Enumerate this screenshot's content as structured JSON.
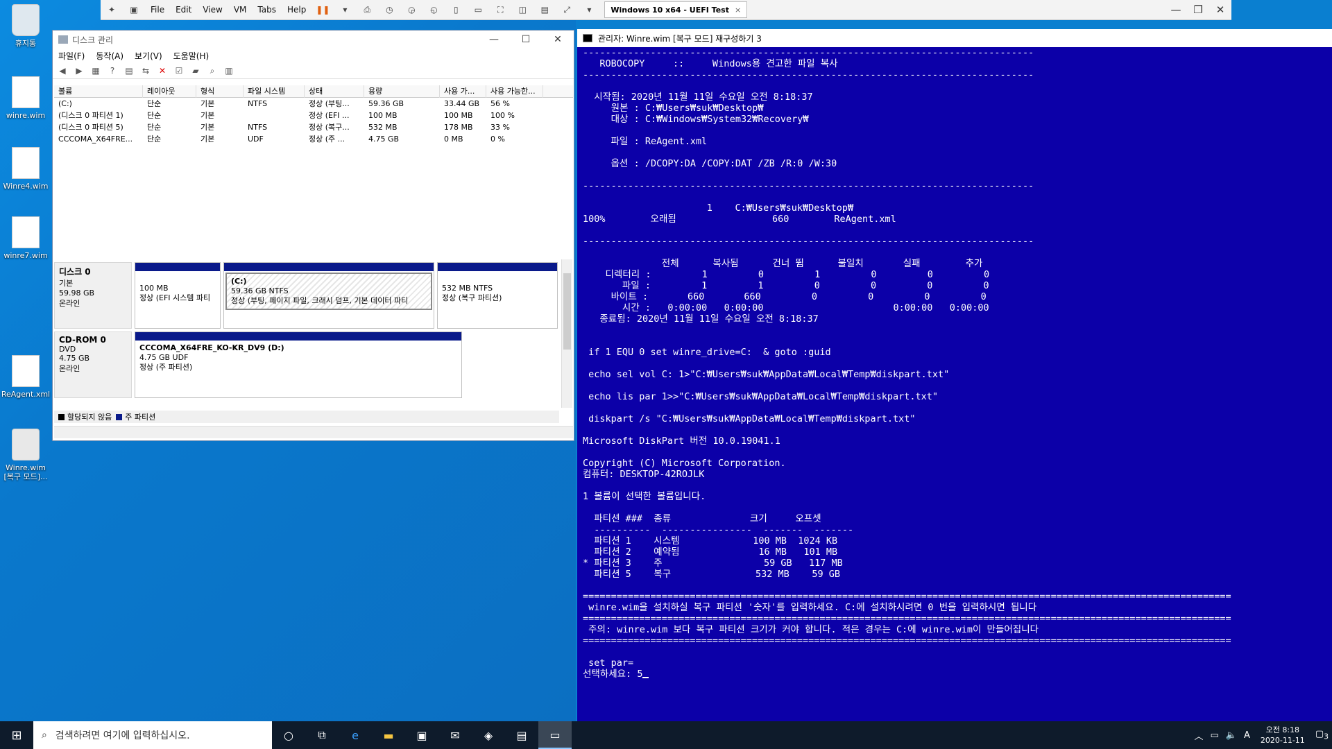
{
  "desktop": {
    "icons": [
      {
        "label": "휴지통",
        "kind": "bin"
      },
      {
        "label": "winre.wim",
        "kind": "file"
      },
      {
        "label": "Winre4.wim",
        "kind": "file"
      },
      {
        "label": "winre7.wim",
        "kind": "file"
      },
      {
        "label": "ReAgent.xml",
        "kind": "xml"
      },
      {
        "label": "Winre.wim [복구 모드]...",
        "kind": "gear"
      }
    ]
  },
  "vmbar": {
    "menus": [
      "File",
      "Edit",
      "View",
      "VM",
      "Tabs",
      "Help"
    ],
    "tab_title": "Windows 10 x64 - UEFI Test"
  },
  "disk_mgmt": {
    "title": "디스크 관리",
    "menus": [
      "파일(F)",
      "동작(A)",
      "보기(V)",
      "도움말(H)"
    ],
    "columns": [
      "볼륨",
      "레이아웃",
      "형식",
      "파일 시스템",
      "상태",
      "용량",
      "사용 가...",
      "사용 가능한..."
    ],
    "rows": [
      [
        "(C:)",
        "단순",
        "기본",
        "NTFS",
        "정상 (부팅...",
        "59.36 GB",
        "33.44 GB",
        "56 %"
      ],
      [
        "(디스크 0 파티션 1)",
        "단순",
        "기본",
        "",
        "정상 (EFI ...",
        "100 MB",
        "100 MB",
        "100 %"
      ],
      [
        "(디스크 0 파티션 5)",
        "단순",
        "기본",
        "NTFS",
        "정상 (복구...",
        "532 MB",
        "178 MB",
        "33 %"
      ],
      [
        "CCCOMA_X64FRE...",
        "단순",
        "기본",
        "UDF",
        "정상 (주 ...",
        "4.75 GB",
        "0 MB",
        "0 %"
      ]
    ],
    "disk0": {
      "name": "디스크 0",
      "type": "기본",
      "size": "59.98 GB",
      "state": "온라인",
      "p1_size": "100 MB",
      "p1_status": "정상 (EFI 시스템 파티",
      "p2_name": "(C:)",
      "p2_size": "59.36 GB NTFS",
      "p2_status": "정상 (부팅, 페이지 파일, 크래시 덤프, 기본 데이터 파티",
      "p3_size": "532 MB NTFS",
      "p3_status": "정상 (복구 파티션)"
    },
    "cdrom": {
      "name": "CD-ROM 0",
      "type": "DVD",
      "size": "4.75 GB",
      "state": "온라인",
      "vol_name": "CCCOMA_X64FRE_KO-KR_DV9  (D:)",
      "vol_size": "4.75 GB UDF",
      "vol_status": "정상 (주 파티션)"
    },
    "legend_unalloc": "할당되지 않음",
    "legend_primary": "주 파티션"
  },
  "console": {
    "title": "관리자:  Winre.wim [복구 모드] 재구성하기 3",
    "text": "--------------------------------------------------------------------------------\n   ROBOCOPY     ::     Windows용 견고한 파일 복사\n--------------------------------------------------------------------------------\n\n  시작됨: 2020년 11월 11일 수요일 오전 8:18:37\n     원본 : C:₩Users₩suk₩Desktop₩\n     대상 : C:₩Windows₩System32₩Recovery₩\n\n     파일 : ReAgent.xml\n\n     옵션 : /DCOPY:DA /COPY:DAT /ZB /R:0 /W:30\n\n--------------------------------------------------------------------------------\n\n                      1    C:₩Users₩suk₩Desktop₩\n100%        오래됨                 660        ReAgent.xml\n\n--------------------------------------------------------------------------------\n\n              전체      복사됨      건너 뜀      불일치       실패        추가\n    디렉터리 :         1         0         1         0         0         0\n       파일 :         1         1         0         0         0         0\n     바이트 :       660       660         0         0         0         0\n       시간 :   0:00:00   0:00:00                       0:00:00   0:00:00\n   종료됨: 2020년 11월 11일 수요일 오전 8:18:37\n\n\n if 1 EQU 0 set winre_drive=C:  & goto :guid\n\n echo sel vol C: 1>\"C:₩Users₩suk₩AppData₩Local₩Temp₩diskpart.txt\"\n\n echo lis par 1>>\"C:₩Users₩suk₩AppData₩Local₩Temp₩diskpart.txt\"\n\n diskpart /s \"C:₩Users₩suk₩AppData₩Local₩Temp₩diskpart.txt\"\n\nMicrosoft DiskPart 버전 10.0.19041.1\n\nCopyright (C) Microsoft Corporation.\n컴퓨터: DESKTOP-42ROJLK\n\n1 볼륨이 선택한 볼륨입니다.\n\n  파티션 ###  종류              크기     오프셋\n  ----------  ----------------  -------  -------\n  파티션 1    시스템             100 MB  1024 KB\n  파티션 2    예약됨              16 MB   101 MB\n* 파티션 3    주                  59 GB   117 MB\n  파티션 5    복구               532 MB    59 GB\n\n===================================================================================================================\n winre.wim을 설치하실 복구 파티션 '숫자'를 입력하세요. C:에 설치하시려면 0 번을 입력하시면 됩니다\n===================================================================================================================\n 주의: winre.wim 보다 복구 파티션 크기가 커야 합니다. 적은 경우는 C:에 winre.wim이 만들어집니다\n===================================================================================================================\n\n set par=\n선택하세요: 5"
  },
  "taskbar": {
    "search_placeholder": "검색하려면 여기에 입력하십시오.",
    "time": "오전 8:18",
    "date": "2020-11-11",
    "ime": "A",
    "notif_count": "3"
  }
}
